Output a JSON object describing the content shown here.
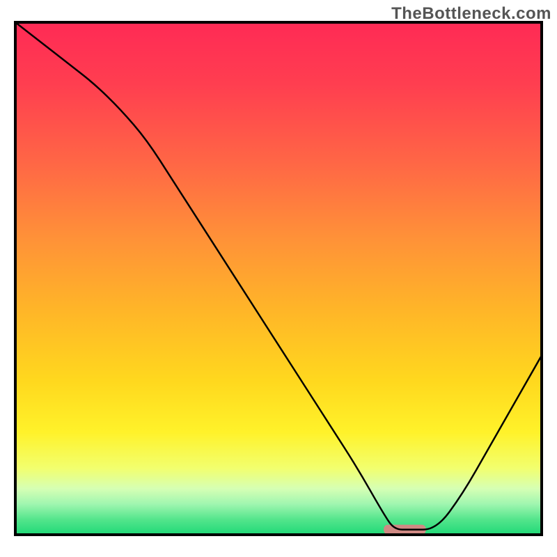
{
  "watermark": "TheBottleneck.com",
  "chart_data": {
    "type": "line",
    "title": "",
    "xlabel": "",
    "ylabel": "",
    "xlim": [
      0,
      100
    ],
    "ylim": [
      0,
      100
    ],
    "grid": false,
    "legend": false,
    "series": [
      {
        "name": "curve",
        "x": [
          0,
          5,
          10,
          15,
          20,
          25,
          30,
          35,
          40,
          45,
          50,
          55,
          60,
          65,
          70,
          72,
          75,
          80,
          85,
          90,
          95,
          100
        ],
        "values": [
          100,
          96,
          92,
          88,
          83,
          77,
          69,
          61,
          53,
          45,
          37,
          29,
          21,
          13,
          4,
          1,
          1,
          1,
          8,
          17,
          26,
          35
        ]
      }
    ],
    "highlight_band": {
      "x_start": 70,
      "x_end": 78,
      "color": "#d08a84"
    },
    "background_gradient": {
      "stops": [
        {
          "offset": 0.0,
          "color": "#ff2a55"
        },
        {
          "offset": 0.12,
          "color": "#ff3e50"
        },
        {
          "offset": 0.28,
          "color": "#ff6845"
        },
        {
          "offset": 0.42,
          "color": "#ff9138"
        },
        {
          "offset": 0.56,
          "color": "#ffb528"
        },
        {
          "offset": 0.7,
          "color": "#ffd81e"
        },
        {
          "offset": 0.8,
          "color": "#fff22a"
        },
        {
          "offset": 0.87,
          "color": "#f2ff6e"
        },
        {
          "offset": 0.91,
          "color": "#d6ffb4"
        },
        {
          "offset": 0.94,
          "color": "#a0f6b0"
        },
        {
          "offset": 0.97,
          "color": "#54e58c"
        },
        {
          "offset": 1.0,
          "color": "#1fd977"
        }
      ]
    },
    "frame_color": "#000000"
  }
}
